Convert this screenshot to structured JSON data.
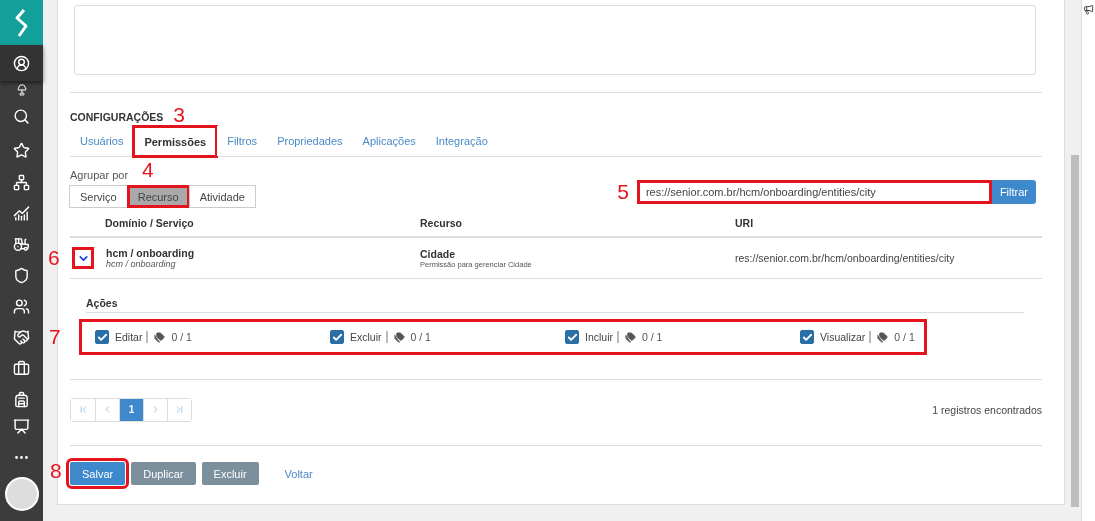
{
  "section": {
    "title": "CONFIGURAÇÕES",
    "callout": "3"
  },
  "tabs": [
    {
      "label": "Usuários",
      "selected": false,
      "marked": false
    },
    {
      "label": "Permissões",
      "selected": true,
      "marked": true
    },
    {
      "label": "Filtros",
      "selected": false,
      "marked": false
    },
    {
      "label": "Propriedades",
      "selected": false,
      "marked": false
    },
    {
      "label": "Aplicações",
      "selected": false,
      "marked": false
    },
    {
      "label": "Integração",
      "selected": false,
      "marked": false
    }
  ],
  "group_by": {
    "label": "Agrupar por",
    "callout": "4",
    "options": [
      {
        "label": "Serviço",
        "selected": false,
        "marked": false
      },
      {
        "label": "Recurso",
        "selected": true,
        "marked": true
      },
      {
        "label": "Atividade",
        "selected": false,
        "marked": false
      }
    ]
  },
  "filter": {
    "value": "res://senior.com.br/hcm/onboarding/entities/city",
    "callout": "5",
    "button": "Filtrar"
  },
  "table": {
    "columns": [
      "Domínio / Serviço",
      "Recurso",
      "URI"
    ],
    "rows": [
      {
        "expanded": true,
        "callout": "6",
        "domain": "hcm / onboarding",
        "domain_sub": "hcm / onboarding",
        "resource": "Cidade",
        "resource_sub": "Permissão para gerenciar Cidade",
        "uri": "res://senior.com.br/hcm/onboarding/entities/city"
      }
    ]
  },
  "actions": {
    "title": "Ações",
    "callout": "7",
    "items": [
      {
        "label": "Editar",
        "checked": true,
        "count": "0 / 1"
      },
      {
        "label": "Excluir",
        "checked": true,
        "count": "0 / 1"
      },
      {
        "label": "Incluir",
        "checked": true,
        "count": "0 / 1"
      },
      {
        "label": "Visualizar",
        "checked": true,
        "count": "0 / 1"
      }
    ]
  },
  "pagination": {
    "pages": [
      {
        "label": "1",
        "selected": true
      }
    ],
    "summary": "1 registros encontrados"
  },
  "footer": {
    "callout": "8",
    "buttons": [
      {
        "label": "Salvar",
        "kind": "primary",
        "marked": true
      },
      {
        "label": "Duplicar",
        "kind": "secondary",
        "marked": false
      },
      {
        "label": "Excluir",
        "kind": "secondary",
        "marked": false
      },
      {
        "label": "Voltar",
        "kind": "link",
        "marked": false
      }
    ]
  }
}
